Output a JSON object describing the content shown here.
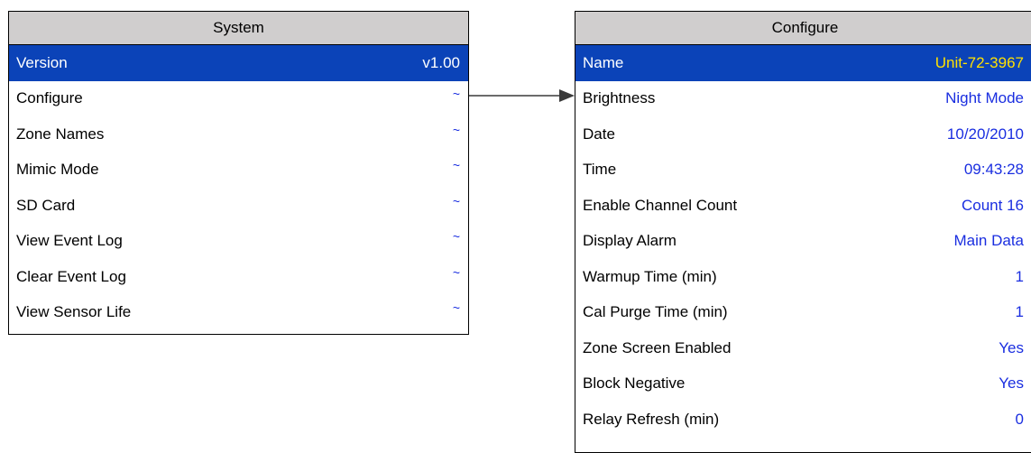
{
  "system": {
    "title": "System",
    "rows": [
      {
        "label": "Version",
        "value": "v1.00"
      },
      {
        "label": "Configure",
        "value": "~"
      },
      {
        "label": "Zone Names",
        "value": "~"
      },
      {
        "label": "Mimic Mode",
        "value": "~"
      },
      {
        "label": "SD Card",
        "value": "~"
      },
      {
        "label": "View Event Log",
        "value": "~"
      },
      {
        "label": "Clear Event Log",
        "value": "~"
      },
      {
        "label": "View Sensor Life",
        "value": "~"
      }
    ]
  },
  "configure": {
    "title": "Configure",
    "rows": [
      {
        "label": "Name",
        "value": "Unit-72-3967"
      },
      {
        "label": "Brightness",
        "value": "Night Mode"
      },
      {
        "label": "Date",
        "value": "10/20/2010"
      },
      {
        "label": "Time",
        "value": "09:43:28"
      },
      {
        "label": "Enable Channel Count",
        "value": "Count 16"
      },
      {
        "label": "Display Alarm",
        "value": "Main Data"
      },
      {
        "label": "Warmup Time (min)",
        "value": "1"
      },
      {
        "label": "Cal Purge Time (min)",
        "value": "1"
      },
      {
        "label": "Zone Screen Enabled",
        "value": "Yes"
      },
      {
        "label": "Block Negative",
        "value": "Yes"
      },
      {
        "label": "Relay Refresh (min)",
        "value": "0"
      }
    ]
  },
  "colors": {
    "header_bg": "#d0cece",
    "selected_bg": "#0b43b8",
    "value_text": "#1a2ee0",
    "selected_value_highlight": "#ffe100"
  }
}
